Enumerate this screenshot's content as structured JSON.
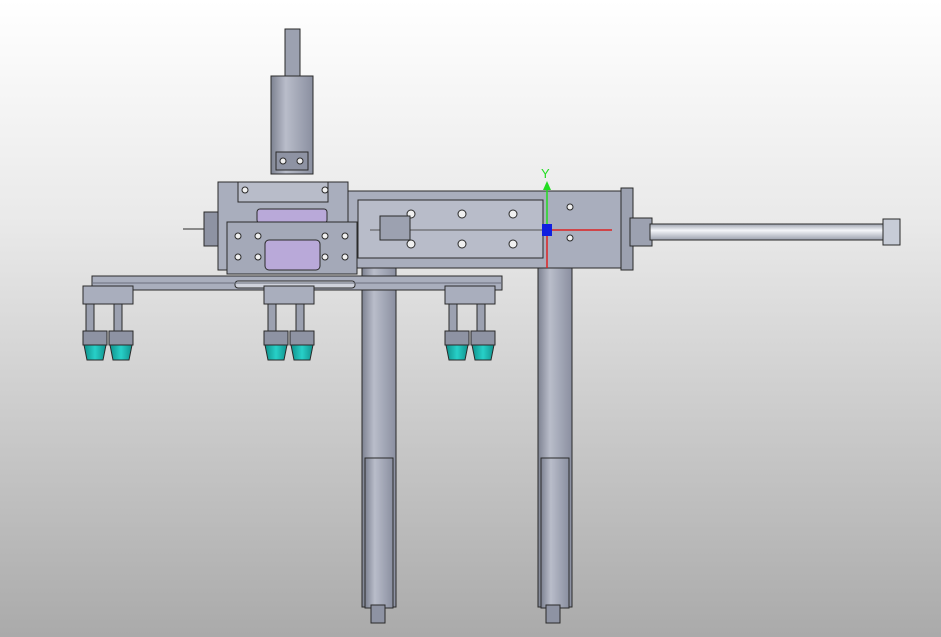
{
  "viewport": {
    "background_top": "#ffffff",
    "background_bottom": "#aaaaaa"
  },
  "triad": {
    "y_label": "Y",
    "y_color": "#22dd22",
    "x_color": "#dd2222",
    "origin_color": "#1020e0"
  },
  "colors": {
    "steel": "#a9aebd",
    "steel_dark": "#8e93a3",
    "edge": "#2a2a2a",
    "suction_cup": "#19b7b0",
    "plate_accent": "#b9a9d9",
    "rod": "#dfe3ea"
  }
}
